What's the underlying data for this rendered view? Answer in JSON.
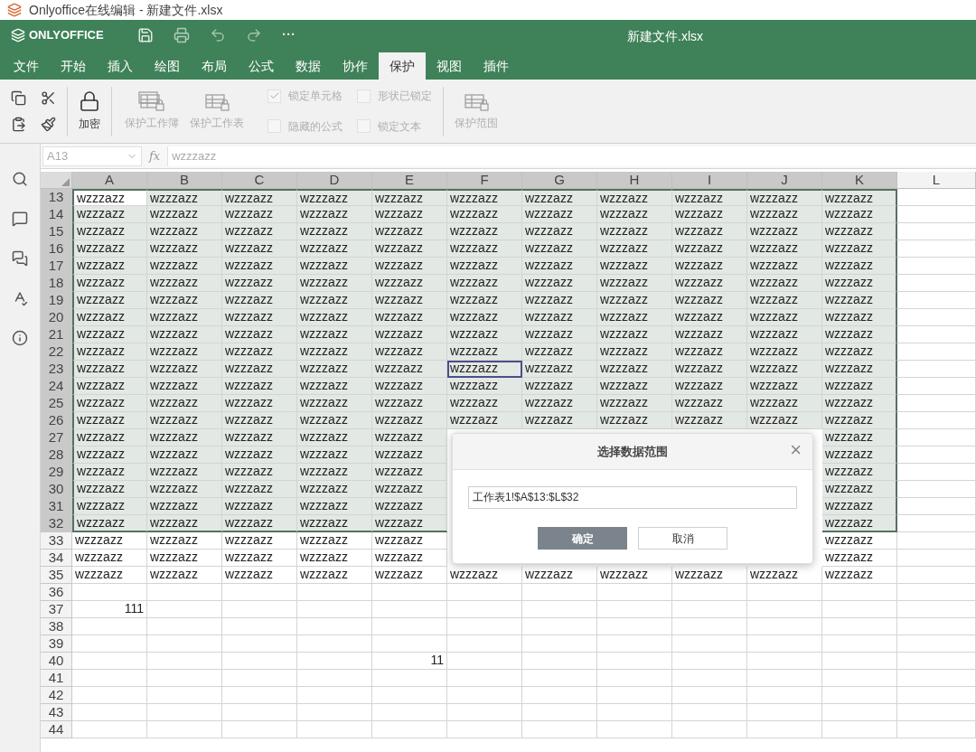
{
  "window_title": "Onlyoffice在线编辑 - 新建文件.xlsx",
  "header": {
    "logo": "ONLYOFFICE",
    "more": "···",
    "document_title": "新建文件.xlsx"
  },
  "tabs": [
    {
      "label": "文件",
      "selected": false
    },
    {
      "label": "开始",
      "selected": false
    },
    {
      "label": "插入",
      "selected": false
    },
    {
      "label": "绘图",
      "selected": false
    },
    {
      "label": "布局",
      "selected": false
    },
    {
      "label": "公式",
      "selected": false
    },
    {
      "label": "数据",
      "selected": false
    },
    {
      "label": "协作",
      "selected": false
    },
    {
      "label": "保护",
      "selected": true
    },
    {
      "label": "视图",
      "selected": false
    },
    {
      "label": "插件",
      "selected": false
    }
  ],
  "toolbar": {
    "encrypt": {
      "label": "加密",
      "disabled": false
    },
    "protect_buttons": [
      {
        "label": "保护工作簿",
        "kind": "workbook",
        "disabled": true
      },
      {
        "label": "保护工作表",
        "kind": "sheet",
        "disabled": true
      }
    ],
    "checkboxes": [
      {
        "label": "锁定单元格",
        "checked": true,
        "disabled": true
      },
      {
        "label": "隐藏的公式",
        "checked": false,
        "disabled": true
      },
      {
        "label": "形状已锁定",
        "checked": false,
        "disabled": true
      },
      {
        "label": "锁定文本",
        "checked": false,
        "disabled": true
      }
    ],
    "range_button": {
      "label": "保护范围",
      "disabled": true
    }
  },
  "formula_bar": {
    "cell_ref": "A13",
    "fx": "fx",
    "value": "wzzzazz"
  },
  "sheet": {
    "columns": [
      {
        "label": "A",
        "selected": true
      },
      {
        "label": "B",
        "selected": true
      },
      {
        "label": "C",
        "selected": true
      },
      {
        "label": "D",
        "selected": true
      },
      {
        "label": "E",
        "selected": true
      },
      {
        "label": "F",
        "selected": true
      },
      {
        "label": "G",
        "selected": true
      },
      {
        "label": "H",
        "selected": true
      },
      {
        "label": "I",
        "selected": true
      },
      {
        "label": "J",
        "selected": true
      },
      {
        "label": "K",
        "selected": true
      },
      {
        "label": "L",
        "selected": false
      }
    ],
    "rows": [
      {
        "number": "13",
        "selected": true,
        "cells": [
          {
            "text": "wzzzazz",
            "active": true
          },
          "wzzzazz",
          "wzzzazz",
          "wzzzazz",
          "wzzzazz",
          "wzzzazz",
          "wzzzazz",
          "wzzzazz",
          "wzzzazz",
          "wzzzazz",
          "wzzzazz",
          null
        ]
      },
      {
        "number": "14",
        "selected": true,
        "cells": [
          "wzzzazz",
          "wzzzazz",
          "wzzzazz",
          "wzzzazz",
          "wzzzazz",
          "wzzzazz",
          "wzzzazz",
          "wzzzazz",
          "wzzzazz",
          "wzzzazz",
          "wzzzazz",
          null
        ]
      },
      {
        "number": "15",
        "selected": true,
        "cells": [
          "wzzzazz",
          "wzzzazz",
          "wzzzazz",
          "wzzzazz",
          "wzzzazz",
          "wzzzazz",
          "wzzzazz",
          "wzzzazz",
          "wzzzazz",
          "wzzzazz",
          "wzzzazz",
          null
        ]
      },
      {
        "number": "16",
        "selected": true,
        "cells": [
          "wzzzazz",
          "wzzzazz",
          "wzzzazz",
          "wzzzazz",
          "wzzzazz",
          "wzzzazz",
          "wzzzazz",
          "wzzzazz",
          "wzzzazz",
          "wzzzazz",
          "wzzzazz",
          null
        ]
      },
      {
        "number": "17",
        "selected": true,
        "cells": [
          "wzzzazz",
          "wzzzazz",
          "wzzzazz",
          "wzzzazz",
          "wzzzazz",
          "wzzzazz",
          "wzzzazz",
          "wzzzazz",
          "wzzzazz",
          "wzzzazz",
          "wzzzazz",
          null
        ]
      },
      {
        "number": "18",
        "selected": true,
        "cells": [
          "wzzzazz",
          "wzzzazz",
          "wzzzazz",
          "wzzzazz",
          "wzzzazz",
          "wzzzazz",
          "wzzzazz",
          "wzzzazz",
          "wzzzazz",
          "wzzzazz",
          "wzzzazz",
          null
        ]
      },
      {
        "number": "19",
        "selected": true,
        "cells": [
          "wzzzazz",
          "wzzzazz",
          "wzzzazz",
          "wzzzazz",
          "wzzzazz",
          "wzzzazz",
          "wzzzazz",
          "wzzzazz",
          "wzzzazz",
          "wzzzazz",
          "wzzzazz",
          null
        ]
      },
      {
        "number": "20",
        "selected": true,
        "cells": [
          "wzzzazz",
          "wzzzazz",
          "wzzzazz",
          "wzzzazz",
          "wzzzazz",
          "wzzzazz",
          "wzzzazz",
          "wzzzazz",
          "wzzzazz",
          "wzzzazz",
          "wzzzazz",
          null
        ]
      },
      {
        "number": "21",
        "selected": true,
        "cells": [
          "wzzzazz",
          "wzzzazz",
          "wzzzazz",
          "wzzzazz",
          "wzzzazz",
          "wzzzazz",
          "wzzzazz",
          "wzzzazz",
          "wzzzazz",
          "wzzzazz",
          "wzzzazz",
          null
        ]
      },
      {
        "number": "22",
        "selected": true,
        "cells": [
          "wzzzazz",
          "wzzzazz",
          "wzzzazz",
          "wzzzazz",
          "wzzzazz",
          "wzzzazz",
          "wzzzazz",
          "wzzzazz",
          "wzzzazz",
          "wzzzazz",
          "wzzzazz",
          null
        ]
      },
      {
        "number": "23",
        "selected": true,
        "cells": [
          "wzzzazz",
          "wzzzazz",
          "wzzzazz",
          "wzzzazz",
          "wzzzazz",
          {
            "text": "wzzzazz",
            "outlined": true
          },
          "wzzzazz",
          "wzzzazz",
          "wzzzazz",
          "wzzzazz",
          "wzzzazz",
          null
        ]
      },
      {
        "number": "24",
        "selected": true,
        "cells": [
          "wzzzazz",
          "wzzzazz",
          "wzzzazz",
          "wzzzazz",
          "wzzzazz",
          "wzzzazz",
          "wzzzazz",
          "wzzzazz",
          "wzzzazz",
          "wzzzazz",
          "wzzzazz",
          null
        ]
      },
      {
        "number": "25",
        "selected": true,
        "cells": [
          "wzzzazz",
          "wzzzazz",
          "wzzzazz",
          "wzzzazz",
          "wzzzazz",
          "wzzzazz",
          "wzzzazz",
          "wzzzazz",
          "wzzzazz",
          "wzzzazz",
          "wzzzazz",
          null
        ]
      },
      {
        "number": "26",
        "selected": true,
        "cells": [
          "wzzzazz",
          "wzzzazz",
          "wzzzazz",
          "wzzzazz",
          "wzzzazz",
          "wzzzazz",
          "wzzzazz",
          "wzzzazz",
          "wzzzazz",
          "wzzzazz",
          "wzzzazz",
          null
        ]
      },
      {
        "number": "27",
        "selected": true,
        "cells": [
          "wzzzazz",
          "wzzzazz",
          "wzzzazz",
          "wzzzazz",
          "wzzzazz",
          null,
          null,
          null,
          null,
          null,
          "wzzzazz",
          null
        ]
      },
      {
        "number": "28",
        "selected": true,
        "cells": [
          "wzzzazz",
          "wzzzazz",
          "wzzzazz",
          "wzzzazz",
          "wzzzazz",
          null,
          null,
          null,
          null,
          null,
          "wzzzazz",
          null
        ]
      },
      {
        "number": "29",
        "selected": true,
        "cells": [
          "wzzzazz",
          "wzzzazz",
          "wzzzazz",
          "wzzzazz",
          "wzzzazz",
          null,
          null,
          null,
          null,
          null,
          "wzzzazz",
          null
        ]
      },
      {
        "number": "30",
        "selected": true,
        "cells": [
          "wzzzazz",
          "wzzzazz",
          "wzzzazz",
          "wzzzazz",
          "wzzzazz",
          null,
          null,
          null,
          null,
          null,
          "wzzzazz",
          null
        ]
      },
      {
        "number": "31",
        "selected": true,
        "cells": [
          "wzzzazz",
          "wzzzazz",
          "wzzzazz",
          "wzzzazz",
          "wzzzazz",
          null,
          null,
          null,
          null,
          null,
          "wzzzazz",
          null
        ]
      },
      {
        "number": "32",
        "selected": true,
        "cells": [
          "wzzzazz",
          "wzzzazz",
          "wzzzazz",
          "wzzzazz",
          "wzzzazz",
          null,
          null,
          null,
          null,
          null,
          "wzzzazz",
          null
        ]
      },
      {
        "number": "33",
        "selected": false,
        "cells": [
          "wzzzazz",
          "wzzzazz",
          "wzzzazz",
          "wzzzazz",
          "wzzzazz",
          null,
          null,
          null,
          null,
          null,
          "wzzzazz",
          null
        ]
      },
      {
        "number": "34",
        "selected": false,
        "cells": [
          "wzzzazz",
          "wzzzazz",
          "wzzzazz",
          "wzzzazz",
          "wzzzazz",
          null,
          null,
          null,
          null,
          null,
          "wzzzazz",
          null
        ]
      },
      {
        "number": "35",
        "selected": false,
        "cells": [
          "wzzzazz",
          "wzzzazz",
          "wzzzazz",
          "wzzzazz",
          "wzzzazz",
          "wzzzazz",
          "wzzzazz",
          "wzzzazz",
          "wzzzazz",
          "wzzzazz",
          "wzzzazz",
          null
        ]
      },
      {
        "number": "36",
        "selected": false,
        "cells": [
          null,
          null,
          null,
          null,
          null,
          null,
          null,
          null,
          null,
          null,
          null,
          null
        ]
      },
      {
        "number": "37",
        "selected": false,
        "cells": [
          {
            "text": "111",
            "kind": "number"
          },
          null,
          null,
          null,
          null,
          null,
          null,
          null,
          null,
          null,
          null,
          null
        ]
      },
      {
        "number": "38",
        "selected": false,
        "cells": [
          null,
          null,
          null,
          null,
          null,
          null,
          null,
          null,
          null,
          null,
          null,
          null
        ]
      },
      {
        "number": "39",
        "selected": false,
        "cells": [
          null,
          null,
          null,
          null,
          null,
          null,
          null,
          null,
          null,
          null,
          null,
          null
        ]
      },
      {
        "number": "40",
        "selected": false,
        "cells": [
          null,
          null,
          null,
          null,
          {
            "text": "11",
            "kind": "number"
          },
          null,
          null,
          null,
          null,
          null,
          null,
          null
        ]
      },
      {
        "number": "41",
        "selected": false,
        "cells": [
          null,
          null,
          null,
          null,
          null,
          null,
          null,
          null,
          null,
          null,
          null,
          null
        ]
      },
      {
        "number": "42",
        "selected": false,
        "cells": [
          null,
          null,
          null,
          null,
          null,
          null,
          null,
          null,
          null,
          null,
          null,
          null
        ]
      },
      {
        "number": "43",
        "selected": false,
        "cells": [
          null,
          null,
          null,
          null,
          null,
          null,
          null,
          null,
          null,
          null,
          null,
          null
        ]
      },
      {
        "number": "44",
        "selected": false,
        "cells": [
          null,
          null,
          null,
          null,
          null,
          null,
          null,
          null,
          null,
          null,
          null,
          null
        ]
      }
    ]
  },
  "dialog": {
    "title": "选择数据范围",
    "close": "×",
    "range_value": "工作表1!$A$13:$L$32",
    "buttons": [
      {
        "label": "确定",
        "kind": "primary"
      },
      {
        "label": "取消",
        "kind": "secondary"
      }
    ]
  }
}
